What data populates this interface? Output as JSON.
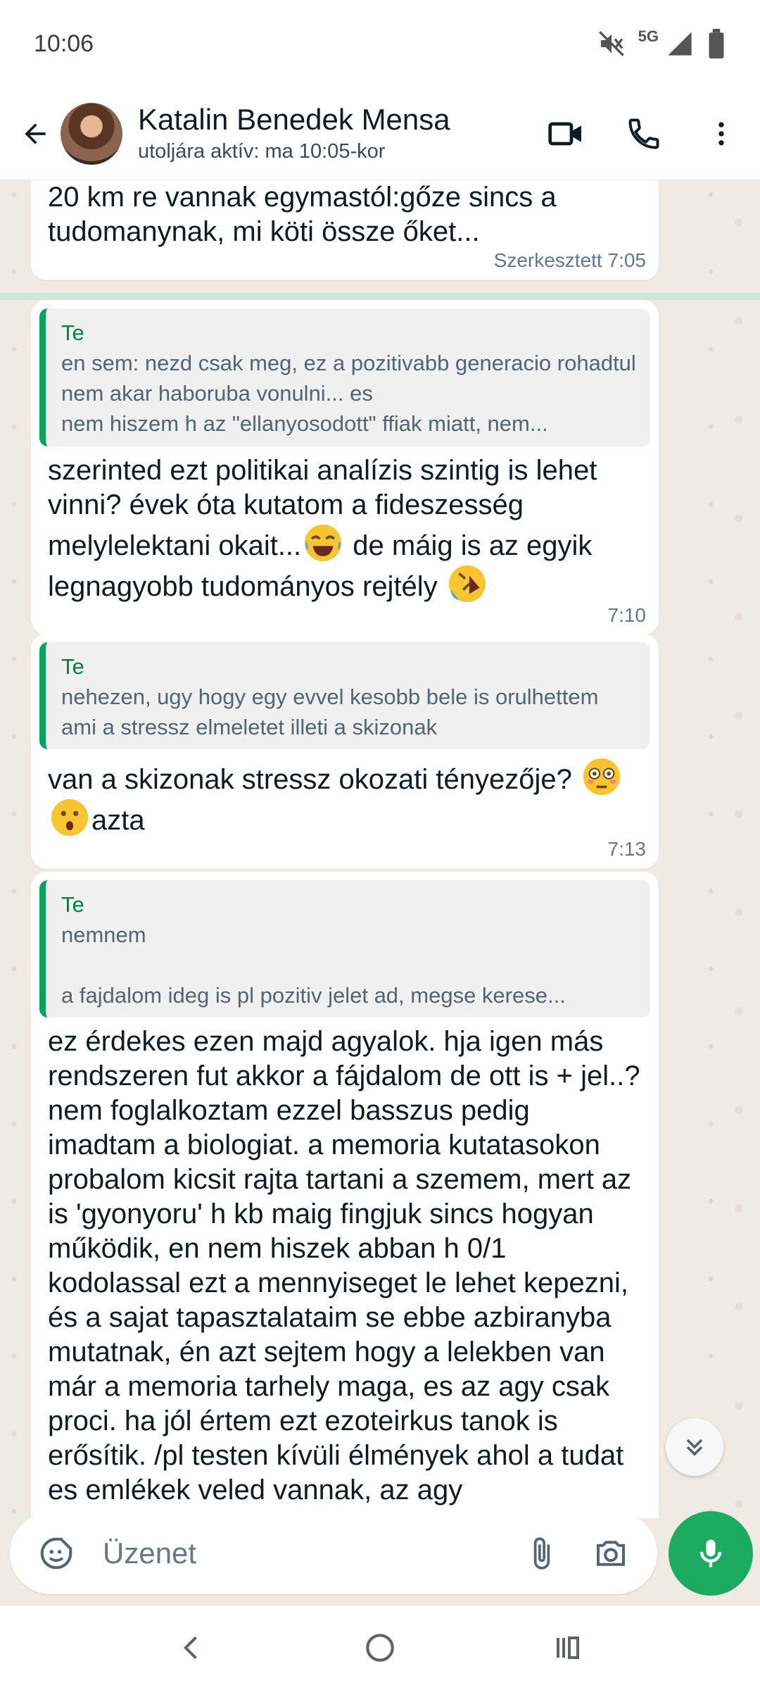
{
  "status_bar": {
    "time": "10:06",
    "network": "5G",
    "icons": [
      "mute-icon",
      "signal-icon",
      "battery-icon"
    ]
  },
  "header": {
    "contact_name": "Katalin Benedek Mensa",
    "last_seen": "utoljára aktív: ma 10:05-kor",
    "icons": [
      "back-arrow-icon",
      "video-call-icon",
      "phone-call-icon",
      "more-vert-icon"
    ]
  },
  "messages": [
    {
      "text": "20 km re vannak egymastól:gőze sincs a tudomanynak, mi köti össze őket...",
      "meta": "Szerkesztett 7:05"
    },
    {
      "quote_author": "Te",
      "quote_text": "en sem: nezd csak meg, ez a pozitivabb generacio rohadtul nem akar haboruba vonulni... es\nnem hiszem h az \"ellanyosodott\" ffiak miatt, nem...",
      "text_a": "szerinted ezt politikai analízis szintig is lehet vinni? évek óta kutatom a fideszesség melylelektani okait...",
      "text_b": " de máig is az egyik legnagyobb tudományos rejtély ",
      "emojis": [
        "face-with-tears-of-joy",
        "rolling-on-floor-laughing"
      ],
      "meta": "7:10"
    },
    {
      "quote_author": "Te",
      "quote_text": "nehezen, ugy hogy egy evvel kesobb bele is orulhettem ami a stressz elmeletet illeti a skizonak",
      "text_a": "van a skizonak stressz okozati tényezője? ",
      "text_b": "azta",
      "emojis": [
        "flushed-face",
        "hushed-face"
      ],
      "meta": "7:13"
    },
    {
      "quote_author": "Te",
      "quote_text": "nemnem\n\na fajdalom ideg is pl pozitiv jelet ad, megse kerese...",
      "text": "ez érdekes ezen majd agyalok. hja igen más rendszeren fut akkor a fájdalom de ott is + jel..? nem foglalkoztam ezzel basszus pedig imadtam a biologiat. a memoria kutatasokon probalom kicsit rajta tartani a szemem, mert az is 'gyonyoru' h kb maig fingjuk sincs hogyan működik,  en nem hiszek abban h 0/1 kodolassal ezt a mennyiseget le lehet kepezni, és a sajat tapasztalataim se ebbe azbiranyba mutatnak, én azt sejtem hogy a lelekben van már a memoria tarhely maga, es az agy csak proci. ha jól értem ezt ezoteirkus tanok is erősítik. /pl testen kívüli élmények ahol a tudat es emlékek veled vannak, az agy"
    }
  ],
  "input": {
    "placeholder": "Üzenet",
    "icons": [
      "sticker-icon",
      "attach-icon",
      "camera-icon",
      "mic-icon"
    ]
  },
  "nav": {
    "icons": [
      "nav-back-icon",
      "nav-home-icon",
      "nav-recents-icon"
    ]
  },
  "colors": {
    "accent_green": "#1daa61",
    "quote_bar": "#06a35d",
    "chat_bg": "#efeae2",
    "bubble_bg": "#ffffff"
  }
}
